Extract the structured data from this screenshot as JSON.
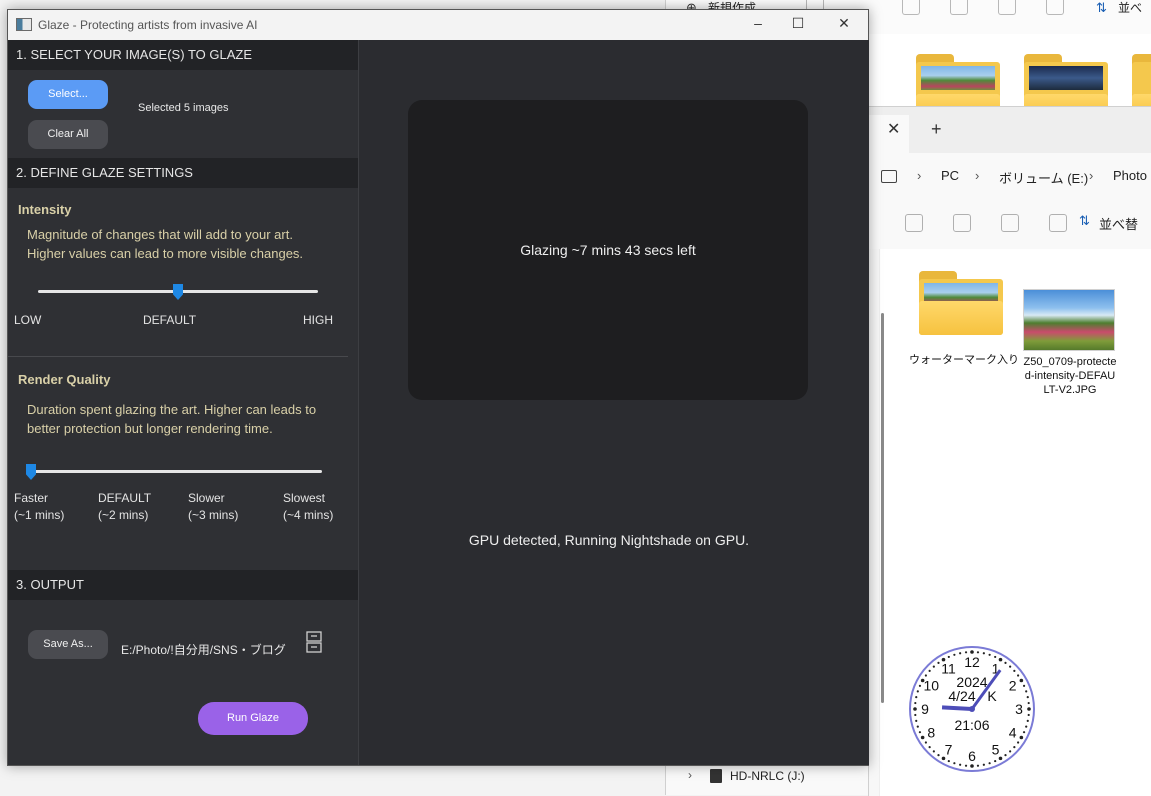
{
  "glaze": {
    "title": "Glaze - Protecting artists from invasive AI",
    "window_controls": {
      "minimize": "–",
      "maximize": "☐",
      "close": "✕"
    },
    "section1": {
      "header": "1. SELECT YOUR IMAGE(S) TO GLAZE",
      "select_label": "Select...",
      "clear_label": "Clear All",
      "selected_text": "Selected 5 images"
    },
    "section2": {
      "header": "2. DEFINE GLAZE SETTINGS",
      "intensity": {
        "heading": "Intensity",
        "desc_line1": "Magnitude of changes that will add to your art.",
        "desc_line2": "Higher values can lead to more visible changes.",
        "tick_low": "LOW",
        "tick_default": "DEFAULT",
        "tick_high": "HIGH",
        "value_fraction": 0.5
      },
      "render": {
        "heading": "Render Quality",
        "desc_line1": "Duration spent glazing the art. Higher can leads to",
        "desc_line2": "better protection but longer rendering time.",
        "ticks": [
          {
            "name": "Faster",
            "time": "(~1 mins)"
          },
          {
            "name": "DEFAULT",
            "time": "(~2 mins)"
          },
          {
            "name": "Slower",
            "time": "(~3 mins)"
          },
          {
            "name": "Slowest",
            "time": "(~4 mins)"
          }
        ],
        "value_fraction": 0.0
      }
    },
    "section3": {
      "header": "3. OUTPUT",
      "save_label": "Save As...",
      "output_path": "E:/Photo/!自分用/SNS・ブログ",
      "run_label": "Run Glaze"
    },
    "preview": {
      "status": "Glazing ~7 mins 43 secs left"
    },
    "gpu_status": "GPU detected, Running Nightshade on GPU."
  },
  "explorer_back": {
    "new_label": "新規作成",
    "sort_label": "並べ"
  },
  "explorer_front": {
    "plus": "+",
    "close": "✕",
    "breadcrumb": [
      "PC",
      "ボリューム (E:)",
      "Photo"
    ],
    "sort_label": "並べ替",
    "folder_label": "ウォーターマーク入り",
    "file_label": "Z50_0709-protected-intensity-DEFAULT-V2.JPG",
    "drive_label": "HD-NRLC (J:)"
  },
  "clock": {
    "numbers": [
      "12",
      "1",
      "2",
      "3",
      "4",
      "5",
      "6",
      "7",
      "8",
      "9",
      "10",
      "11"
    ],
    "year": "2024",
    "date": "4/24",
    "day": "K",
    "time": "21:06",
    "hour_value": 21.1,
    "minute_value": 6
  },
  "colors": {
    "accent_blue": "#5b9bf5",
    "run_purple": "#9a62e8",
    "slider_blue": "#1e88e5",
    "label_gold": "#d9d0a8"
  }
}
